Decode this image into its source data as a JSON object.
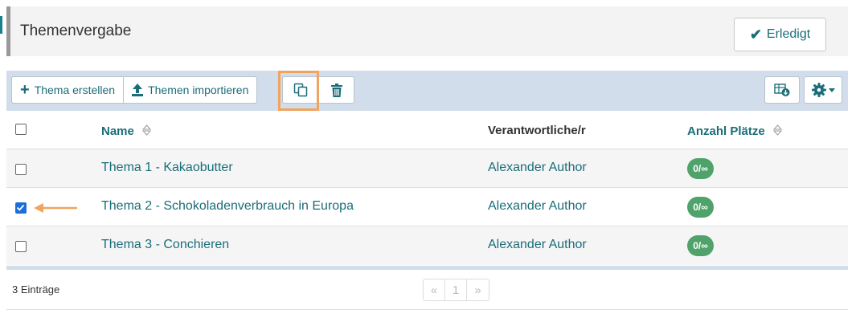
{
  "header": {
    "title": "Themenvergabe",
    "done_label": "Erledigt"
  },
  "toolbar": {
    "create_label": "Thema erstellen",
    "import_label": "Themen importieren",
    "highlight_color": "#f0a45d"
  },
  "table": {
    "columns": {
      "name": "Name",
      "responsible": "Verantwortliche/r",
      "seats": "Anzahl Plätze"
    },
    "rows": [
      {
        "checked": false,
        "name": "Thema 1 - Kakaobutter",
        "responsible": "Alexander Author",
        "seats": "0/∞"
      },
      {
        "checked": true,
        "name": "Thema 2 - Schokoladenverbrauch in Europa",
        "responsible": "Alexander Author",
        "seats": "0/∞"
      },
      {
        "checked": false,
        "name": "Thema 3 - Conchieren",
        "responsible": "Alexander Author",
        "seats": "0/∞"
      }
    ]
  },
  "footer": {
    "count_label": "3 Einträge",
    "pager": {
      "prev": "«",
      "page": "1",
      "next": "»"
    }
  },
  "colors": {
    "accent": "#1a6d79",
    "badge": "#4fa36a",
    "toolbar_bg": "#d1ddea",
    "annotation": "#f0a45d"
  }
}
